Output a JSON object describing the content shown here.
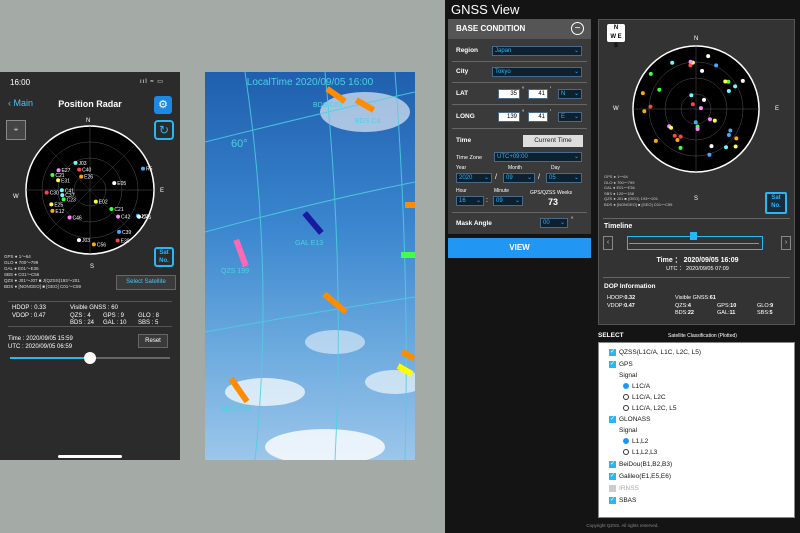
{
  "phone1": {
    "status_time": "16:00",
    "status_icons": "ııl ≈ ▭",
    "back_label": "Main",
    "title": "Position Radar",
    "compass": "N",
    "directions": {
      "n": "N",
      "e": "E",
      "s": "S",
      "w": "W"
    },
    "radar_labels": [
      "C30",
      "C21",
      "E25",
      "J02",
      "E27",
      "J03",
      "E26",
      "C41",
      "C40",
      "C21",
      "E02",
      "R5",
      "C42",
      "E05",
      "E12",
      "J03",
      "E30",
      "C23",
      "E31",
      "C39",
      "C46",
      "C45",
      "C56",
      "C37"
    ],
    "legend": [
      "GPS ● 1〜64",
      "GLO ● 700〜799",
      "GAL ● E01〜E36",
      "SBS ● C01〜C56",
      "QZS ● J01〜J07  ■ J(QZSS)193〜201",
      "BDS ● [NONGEO] ■ [GEO] C01〜C59"
    ],
    "sat_button": "Sat\nNo.",
    "select_satellite": "Select Satellite",
    "dop": {
      "hdop": "HDOP : 0.33",
      "vdop": "VDOP : 0.47",
      "visible": "Visible GNSS : 60",
      "qzs": "QZS : 4",
      "bds": "BDS : 24",
      "gps": "GPS : 9",
      "gal": "GAL : 10",
      "glo": "GLO : 8",
      "sbs": "SBS : 5"
    },
    "time": "Time : 2020/09/05 15:59",
    "utc": "UTC : 2020/09/05 06:59",
    "reset": "Reset",
    "slider_fraction": 0.5
  },
  "phone2": {
    "local_time": "LocalTime 2020/09/05 16:00",
    "labels": [
      "BDS C03",
      "BDS C0",
      "60°",
      "GAL E13",
      "QZS 199",
      "BDS C28"
    ]
  },
  "gnss": {
    "title": "GNSS View",
    "base_condition": "BASE CONDITION",
    "region_label": "Region",
    "region_value": "Japan",
    "city_label": "City",
    "city_value": "Tokyo",
    "lat_label": "LAT",
    "lat_deg": "35",
    "lat_min": "41",
    "lat_dir": "N",
    "long_label": "LONG",
    "long_deg": "139",
    "long_min": "41",
    "long_dir": "E",
    "time_label": "Time",
    "current_time": "Current Time",
    "timezone_label": "Time Zone",
    "timezone_value": "UTC+09:00",
    "year_label": "Year",
    "month_label": "Month",
    "day_label": "Day",
    "year": "2020",
    "month": "09",
    "day": "05",
    "hour_label": "Hour",
    "minute_label": "Minute",
    "weeks_label": "GPS/QZSS Weeks",
    "hour": "16",
    "minute": "09",
    "weeks": "73",
    "mask_label": "Mask Angle",
    "mask_value": "00",
    "view": "VIEW",
    "compass": "N\nW E\nS",
    "directions": {
      "n": "N",
      "e": "E",
      "s": "S",
      "w": "W"
    },
    "legend": [
      "GPS ● 1〜64",
      "GLO ● 700〜799",
      "GAL ● E01〜E36",
      "SBS ● 120〜158",
      "QZS ● J01 ■ (GEO) 193〜201",
      "BDS ● [NONGEO] ■ [GEO] C01〜C59"
    ],
    "sat_button": "Sat\nNo.",
    "timeline": "Timeline",
    "time": "Time ： 2020/09/05 16:09",
    "utc": "UTC ： 2020/09/05 07:09",
    "dop_info": "DOP Information",
    "hdop_label": "HDOP:",
    "hdop": "0.32",
    "vdop_label": "VDOP:",
    "vdop": "0.47",
    "visible_label": "Visible GNSS:",
    "visible": "61",
    "qzs_label": "QZS:",
    "qzs": "4",
    "gps_label": "GPS:",
    "gps": "10",
    "glo_label": "GLO:",
    "glo": "9",
    "bds_label": "BDS:",
    "bds": "22",
    "gal_label": "GAL:",
    "gal": "11",
    "sbs_label": "SBS:",
    "sbs": "5",
    "select": "SELECT",
    "classification": "Satellite Classification (Plotted)",
    "items": {
      "qzss": "QZSS(L1C/A, L1C, L2C, L5)",
      "gps": "GPS",
      "signal1": "Signal",
      "gps_l1ca": "L1C/A",
      "gps_l1ca_l2c": "L1C/A, L2C",
      "gps_l1ca_l2c_l5": "L1C/A, L2C, L5",
      "glonass": "GLONASS",
      "signal2": "Signal",
      "glo_l1l2": "L1,L2",
      "glo_l1l2l3": "L1,L2,L3",
      "beidou": "BeiDou(B1,B2,B3)",
      "galileo": "Galileo(E1,E5,E6)",
      "irnss": "IRNSS",
      "sbas": "SBAS"
    },
    "copyright": "Copyright QZSS. All rights reserved."
  }
}
